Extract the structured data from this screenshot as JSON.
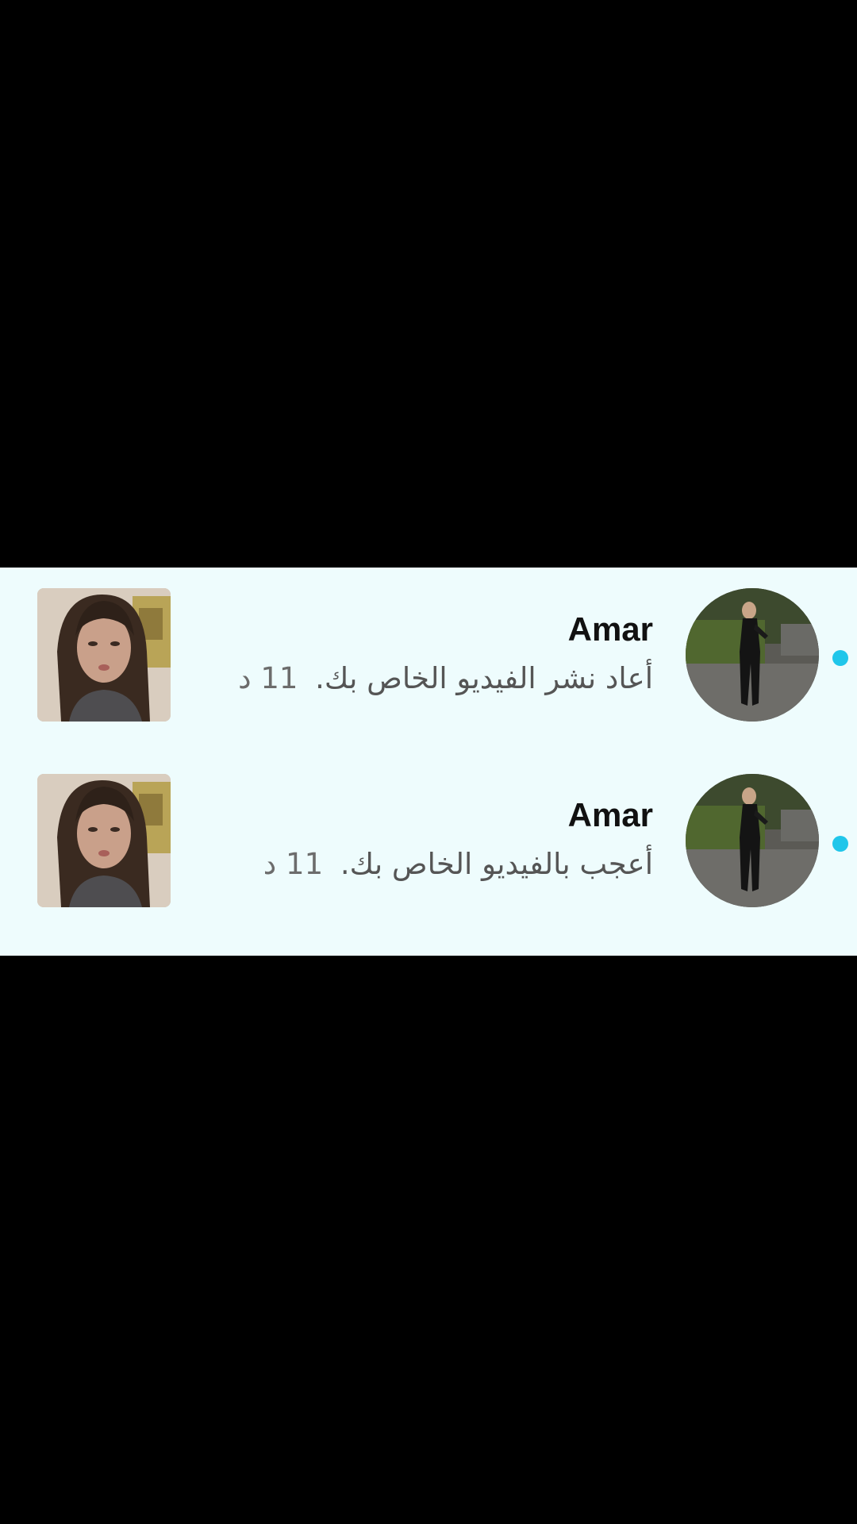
{
  "colors": {
    "background": "#eefcfd",
    "letterbox": "#000000",
    "unread_dot": "#20c6ea",
    "username": "#111111",
    "message": "#555555"
  },
  "notifications": [
    {
      "username": "Amar",
      "action": "أعاد نشر الفيديو الخاص بك.",
      "time": "11 د",
      "unread": true,
      "avatar_icon": "profile-photo-icon",
      "thumbnail_icon": "video-thumbnail-icon"
    },
    {
      "username": "Amar",
      "action": "أعجب بالفيديو الخاص بك.",
      "time": "11 د",
      "unread": true,
      "avatar_icon": "profile-photo-icon",
      "thumbnail_icon": "video-thumbnail-icon"
    }
  ]
}
